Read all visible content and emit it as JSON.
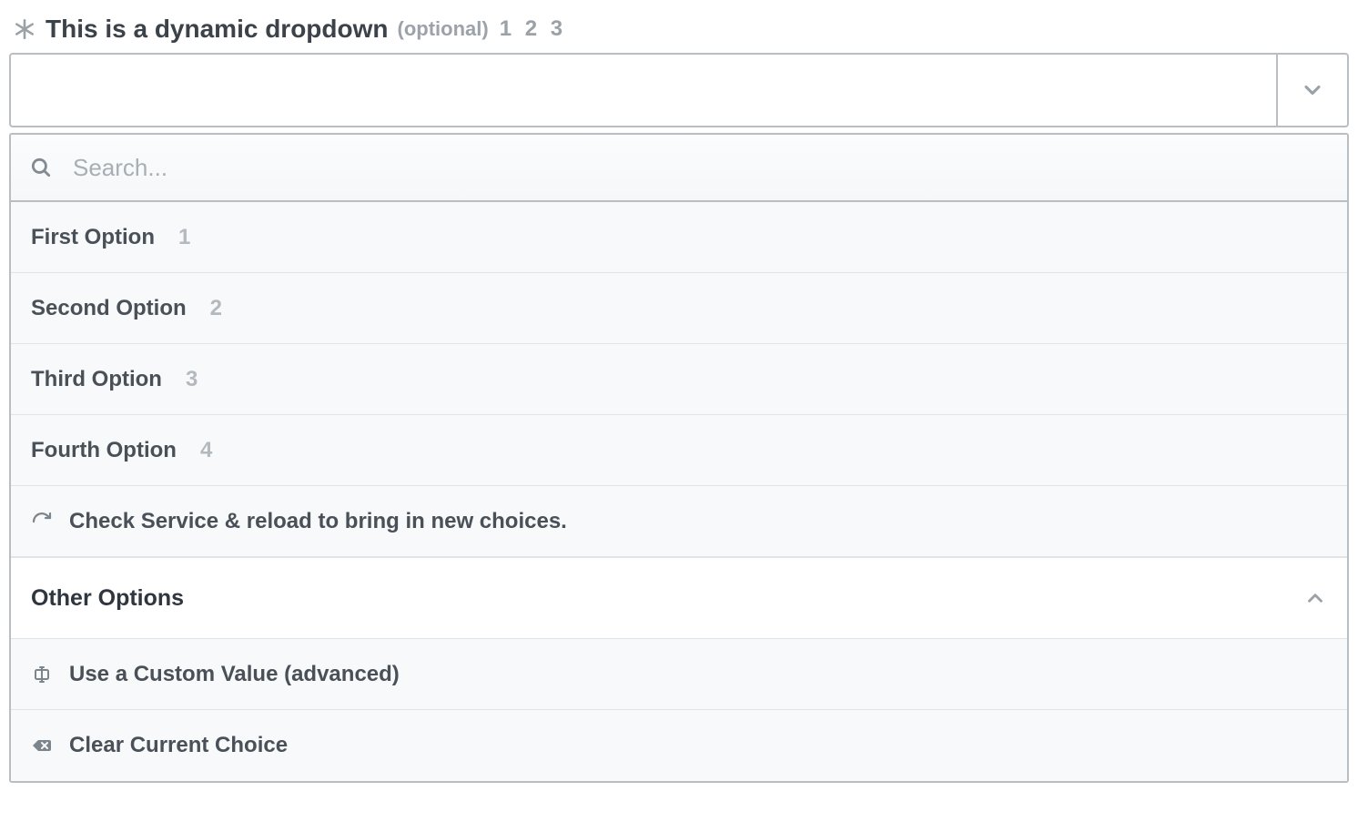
{
  "header": {
    "title": "This is a dynamic dropdown",
    "optional": "(optional)",
    "nums": "1 2 3"
  },
  "search": {
    "placeholder": "Search..."
  },
  "options": [
    {
      "label": "First Option",
      "sub": "1"
    },
    {
      "label": "Second Option",
      "sub": "2"
    },
    {
      "label": "Third Option",
      "sub": "3"
    },
    {
      "label": "Fourth Option",
      "sub": "4"
    }
  ],
  "reload_label": "Check Service & reload to bring in new choices.",
  "other_options_label": "Other Options",
  "custom_value_label": "Use a Custom Value (advanced)",
  "clear_label": "Clear Current Choice"
}
